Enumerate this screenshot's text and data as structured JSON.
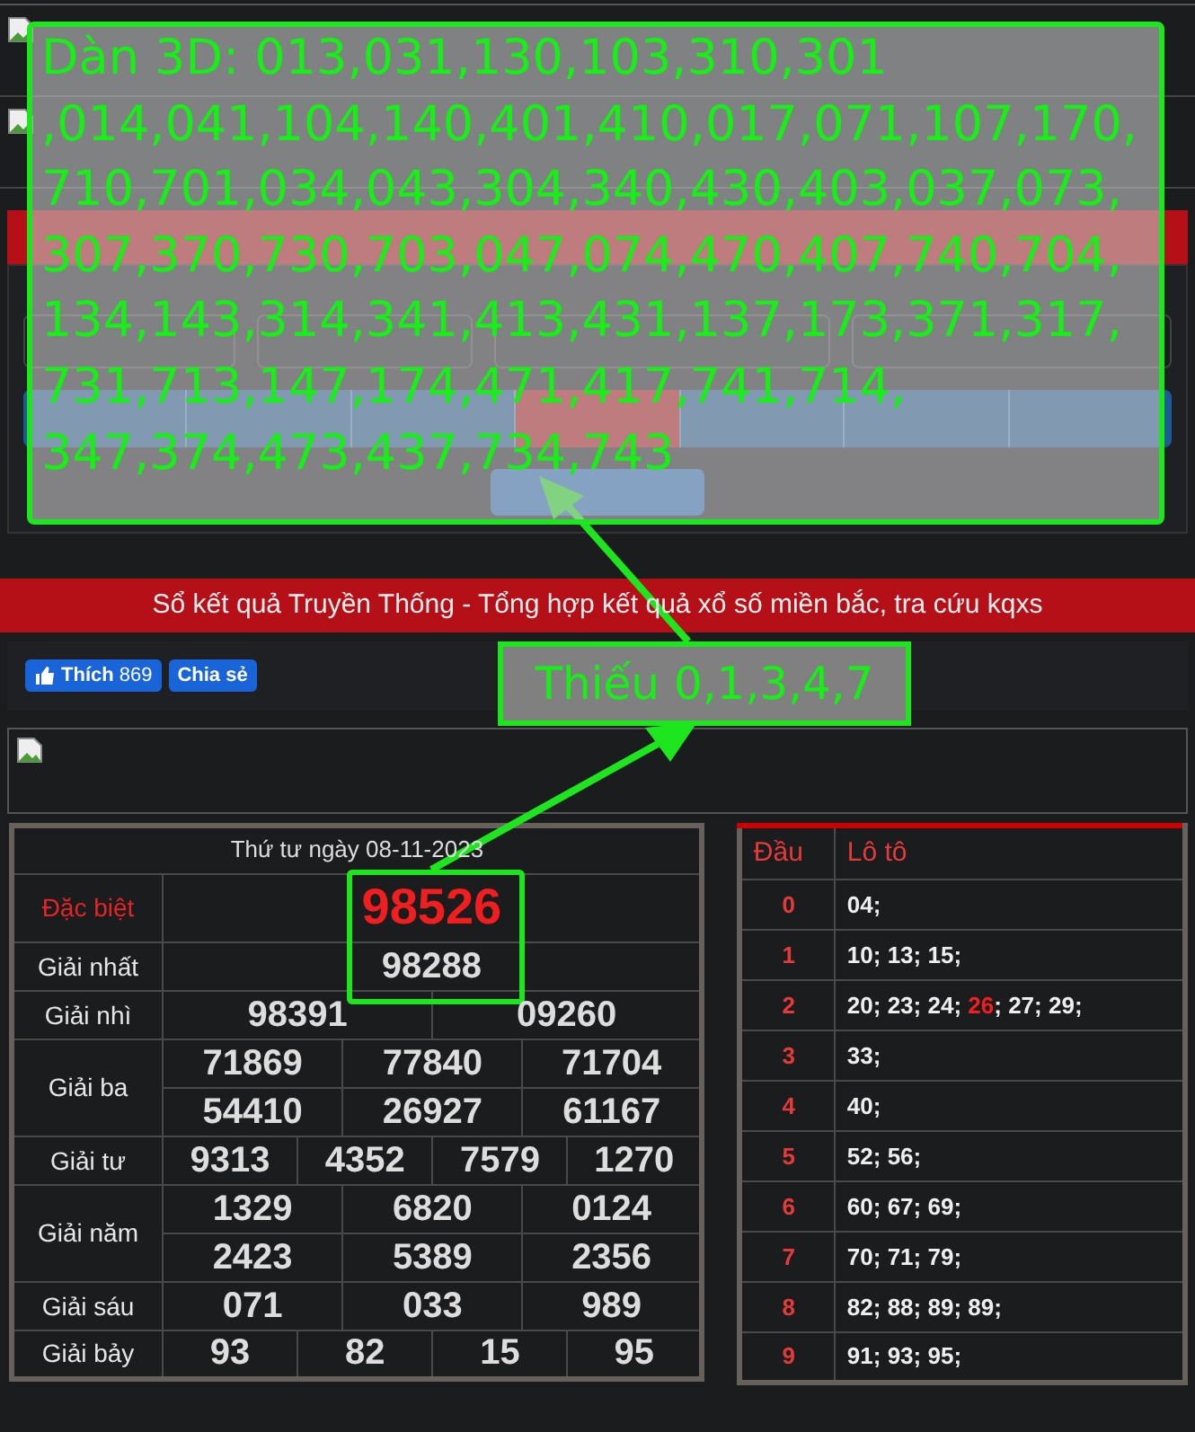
{
  "form": {
    "ranges": [
      {
        "selected": false
      },
      {
        "selected": false
      },
      {
        "selected": false
      },
      {
        "selected": true
      },
      {
        "selected": false
      },
      {
        "selected": false
      },
      {
        "selected": false
      }
    ]
  },
  "note": "Dàn 3D: 013,031,130,103,310,301\n,014,041,104,140,401,410,017,071,107,170,710,701,034,043,304,340,430,403,037,073,307,370,730,703,047,074,470,407,740,704,134,143,314,341,413,431,137,173,371,317,731,713,147,174,471,417,741,714,\n347,374,473,437,734,743",
  "section_title": "Sổ kết quả Truyền Thống - Tổng hợp kết quả xổ số miền bắc, tra cứu kqxs",
  "social": {
    "like": "Thích",
    "like_count": "869",
    "share": "Chia sẻ"
  },
  "callout": "Thiếu 0,1,3,4,7",
  "results": {
    "date": "Thứ tư ngày 08-11-2023",
    "prizes": [
      {
        "kind": "special",
        "name": "Đặc biệt",
        "rows": [
          [
            "98526"
          ]
        ]
      },
      {
        "kind": "normal",
        "name": "Giải nhất",
        "rows": [
          [
            "98288"
          ]
        ]
      },
      {
        "kind": "normal",
        "name": "Giải nhì",
        "rows": [
          [
            "98391",
            "09260"
          ]
        ]
      },
      {
        "kind": "normal",
        "name": "Giải ba",
        "rows": [
          [
            "71869",
            "77840",
            "71704"
          ],
          [
            "54410",
            "26927",
            "61167"
          ]
        ]
      },
      {
        "kind": "normal",
        "name": "Giải tư",
        "rows": [
          [
            "9313",
            "4352",
            "7579",
            "1270"
          ]
        ]
      },
      {
        "kind": "normal",
        "name": "Giải năm",
        "rows": [
          [
            "1329",
            "6820",
            "0124"
          ],
          [
            "2423",
            "5389",
            "2356"
          ]
        ]
      },
      {
        "kind": "normal",
        "name": "Giải sáu",
        "rows": [
          [
            "071",
            "033",
            "989"
          ]
        ]
      },
      {
        "kind": "normal",
        "name": "Giải bảy",
        "rows": [
          [
            "93",
            "82",
            "15",
            "95"
          ]
        ]
      }
    ]
  },
  "loto": {
    "columns": [
      "Đầu",
      "Lô tô"
    ],
    "separator": ";",
    "rows": [
      {
        "head": "0",
        "numbers": [
          {
            "value": "04",
            "highlight": false
          }
        ]
      },
      {
        "head": "1",
        "numbers": [
          {
            "value": "10",
            "highlight": false
          },
          {
            "value": "13",
            "highlight": false
          },
          {
            "value": "15",
            "highlight": false
          }
        ]
      },
      {
        "head": "2",
        "numbers": [
          {
            "value": "20",
            "highlight": false
          },
          {
            "value": "23",
            "highlight": false
          },
          {
            "value": "24",
            "highlight": false
          },
          {
            "value": "26",
            "highlight": true
          },
          {
            "value": "27",
            "highlight": false
          },
          {
            "value": "29",
            "highlight": false
          }
        ]
      },
      {
        "head": "3",
        "numbers": [
          {
            "value": "33",
            "highlight": false
          }
        ]
      },
      {
        "head": "4",
        "numbers": [
          {
            "value": "40",
            "highlight": false
          }
        ]
      },
      {
        "head": "5",
        "numbers": [
          {
            "value": "52",
            "highlight": false
          },
          {
            "value": "56",
            "highlight": false
          }
        ]
      },
      {
        "head": "6",
        "numbers": [
          {
            "value": "60",
            "highlight": false
          },
          {
            "value": "67",
            "highlight": false
          },
          {
            "value": "69",
            "highlight": false
          }
        ]
      },
      {
        "head": "7",
        "numbers": [
          {
            "value": "70",
            "highlight": false
          },
          {
            "value": "71",
            "highlight": false
          },
          {
            "value": "79",
            "highlight": false
          }
        ]
      },
      {
        "head": "8",
        "numbers": [
          {
            "value": "82",
            "highlight": false
          },
          {
            "value": "88",
            "highlight": false
          },
          {
            "value": "89",
            "highlight": false
          },
          {
            "value": "89",
            "highlight": false
          }
        ]
      },
      {
        "head": "9",
        "numbers": [
          {
            "value": "91",
            "highlight": false
          },
          {
            "value": "93",
            "highlight": false
          },
          {
            "value": "95",
            "highlight": false
          }
        ]
      }
    ]
  }
}
